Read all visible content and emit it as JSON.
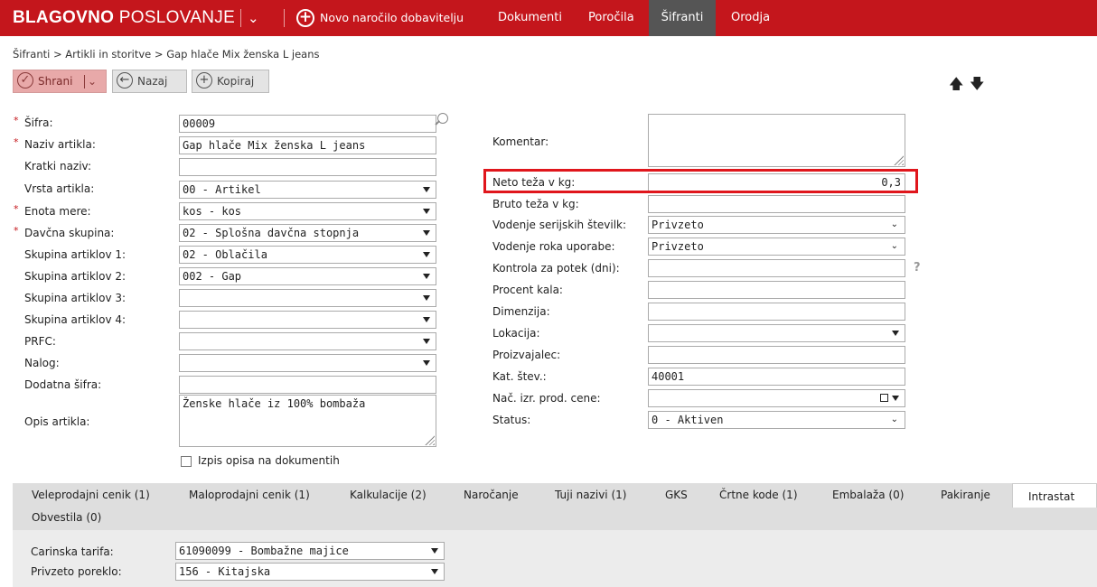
{
  "header": {
    "brand_bold": "BLAGOVNO",
    "brand_light": "POSLOVANJE",
    "new_order": "Novo naročilo dobavitelju",
    "menu": [
      "Dokumenti",
      "Poročila",
      "Šifranti",
      "Orodja"
    ],
    "active_menu": "Šifranti"
  },
  "breadcrumb": "Šifranti > Artikli in storitve > Gap hlače Mix ženska L jeans",
  "toolbar": {
    "save": "Shrani",
    "back": "Nazaj",
    "copy": "Kopiraj",
    "up_icon": "arrow-up-icon",
    "down_icon": "arrow-down-icon"
  },
  "left_form": {
    "sifra": {
      "label": "Šifra:",
      "value": "00009"
    },
    "naziv": {
      "label": "Naziv artikla:",
      "value": "Gap hlače Mix ženska L jeans"
    },
    "kratki": {
      "label": "Kratki naziv:",
      "value": ""
    },
    "vrsta": {
      "label": "Vrsta artikla:",
      "value": "00 - Artikel"
    },
    "enota": {
      "label": "Enota mere:",
      "value": "kos - kos"
    },
    "davcna": {
      "label": "Davčna skupina:",
      "value": "02 - Splošna davčna stopnja"
    },
    "skupina1": {
      "label": "Skupina artiklov 1:",
      "value": "02 - Oblačila"
    },
    "skupina2": {
      "label": "Skupina artiklov 2:",
      "value": "002 - Gap"
    },
    "skupina3": {
      "label": "Skupina artiklov 3:",
      "value": ""
    },
    "skupina4": {
      "label": "Skupina artiklov 4:",
      "value": ""
    },
    "prfc": {
      "label": "PRFC:",
      "value": ""
    },
    "nalog": {
      "label": "Nalog:",
      "value": ""
    },
    "dodatna": {
      "label": "Dodatna šifra:",
      "value": ""
    },
    "opis": {
      "label": "Opis artikla:",
      "value": "Ženske hlače iz 100% bombaža"
    },
    "izpis": {
      "label": "Izpis opisa na dokumentih",
      "checked": false
    }
  },
  "right_form": {
    "komentar": {
      "label": "Komentar:",
      "value": ""
    },
    "neto": {
      "label": "Neto teža v kg:",
      "value": "0,3"
    },
    "bruto": {
      "label": "Bruto teža v kg:",
      "value": ""
    },
    "serijske": {
      "label": "Vodenje serijskih številk:",
      "value": "Privzeto"
    },
    "roka": {
      "label": "Vodenje roka uporabe:",
      "value": "Privzeto"
    },
    "kontrola": {
      "label": "Kontrola za potek (dni):",
      "value": ""
    },
    "procent": {
      "label": "Procent kala:",
      "value": ""
    },
    "dimenzija": {
      "label": "Dimenzija:",
      "value": ""
    },
    "lokacija": {
      "label": "Lokacija:",
      "value": ""
    },
    "proizvajalec": {
      "label": "Proizvajalec:",
      "value": ""
    },
    "kat": {
      "label": "Kat. štev.:",
      "value": "40001"
    },
    "nac": {
      "label": "Nač. izr. prod. cene:",
      "value": ""
    },
    "status": {
      "label": "Status:",
      "value": "0 - Aktiven"
    },
    "help": "?"
  },
  "tabs": [
    "Veleprodajni cenik (1)",
    "Maloprodajni cenik (1)",
    "Kalkulacije (2)",
    "Naročanje",
    "Tuji nazivi (1)",
    "GKS",
    "Črtne kode (1)",
    "Embalaža (0)",
    "Pakiranje",
    "Intrastat",
    "Obvestila (0)"
  ],
  "active_tab": "Intrastat",
  "intrastat": {
    "tarifa": {
      "label": "Carinska tarifa:",
      "value": "61090099 - Bombažne majice"
    },
    "poreklo": {
      "label": "Privzeto poreklo:",
      "value": "156 - Kitajska"
    }
  },
  "colors": {
    "brand": "#c4161c",
    "highlight": "#e0161c"
  }
}
